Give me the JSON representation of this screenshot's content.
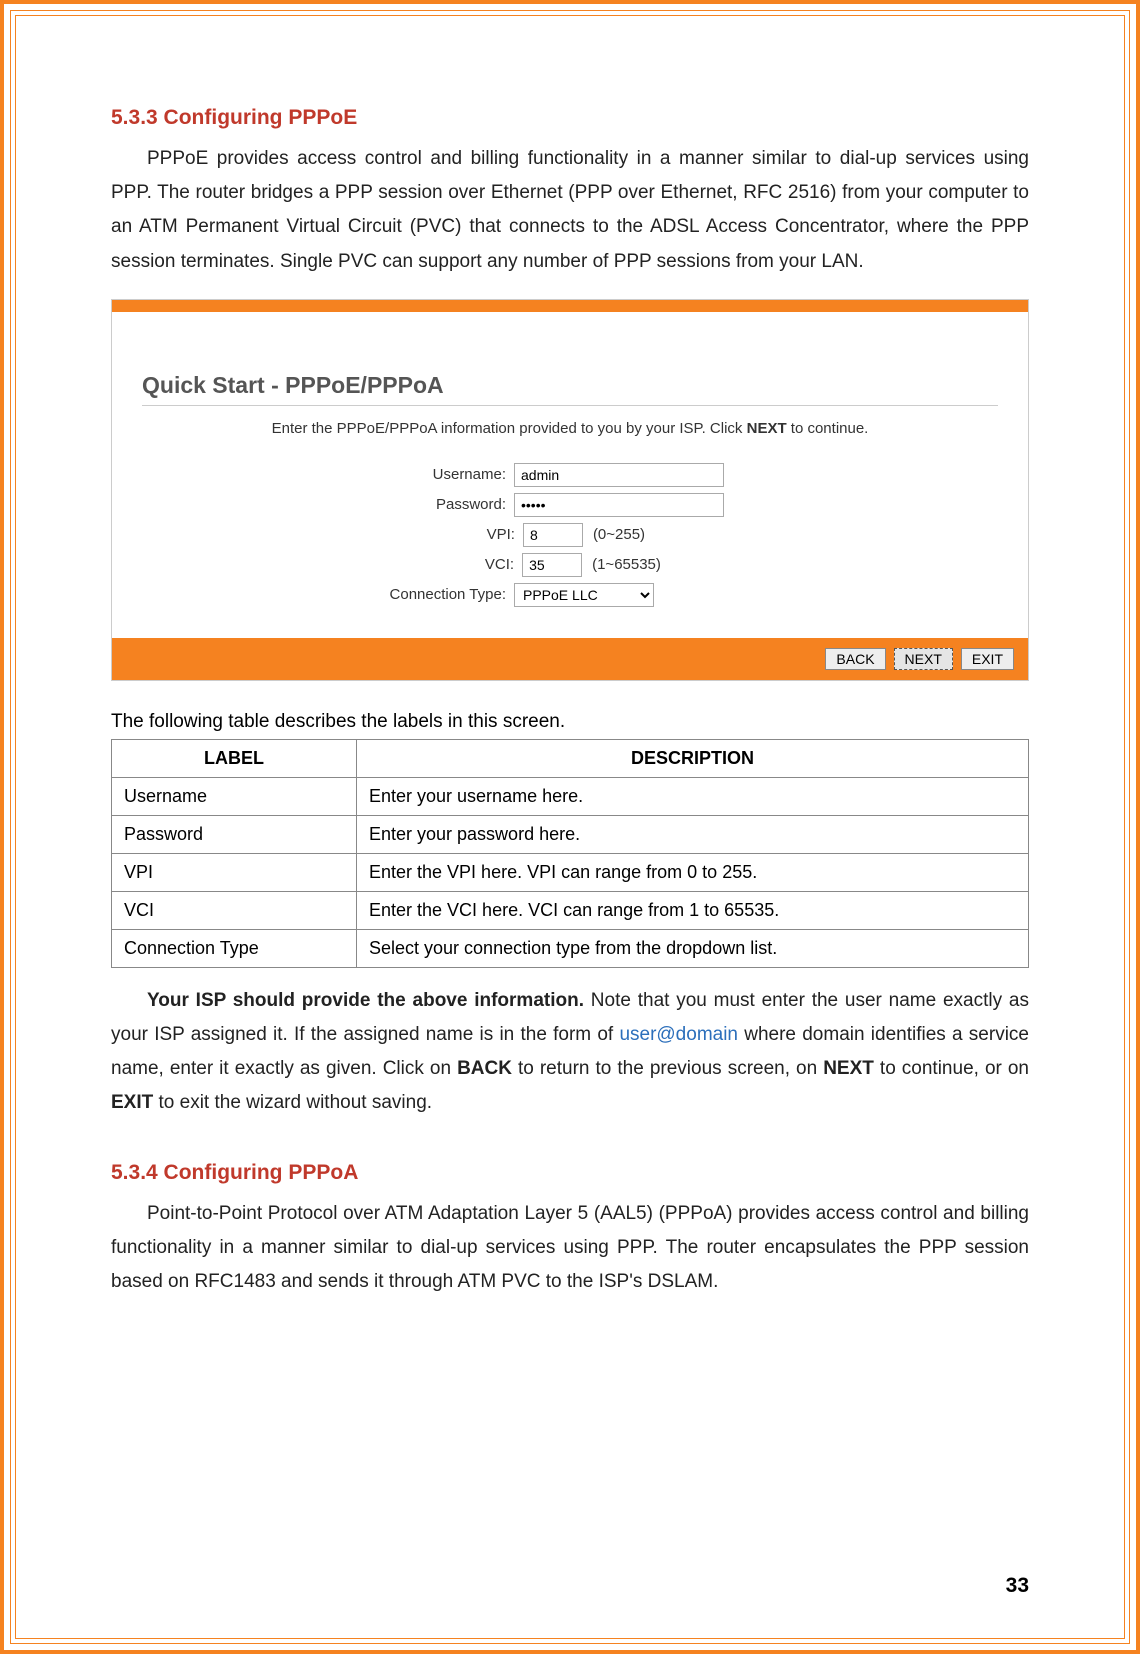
{
  "section1": {
    "heading": "5.3.3 Configuring PPPoE",
    "para": "PPPoE provides access control and billing functionality in a manner similar to dial-up services using PPP. The router bridges a PPP session over Ethernet (PPP over Ethernet, RFC 2516) from your computer to an ATM Permanent Virtual Circuit (PVC) that connects to the ADSL Access Concentrator, where the PPP session terminates. Single PVC can support any number of PPP sessions from your LAN."
  },
  "shot": {
    "title": "Quick Start - PPPoE/PPPoA",
    "instr_pre": "Enter the PPPoE/PPPoA information provided to you by your ISP. Click ",
    "instr_bold": "NEXT",
    "instr_post": " to continue.",
    "labels": {
      "username": "Username:",
      "password": "Password:",
      "vpi": "VPI:",
      "vci": "VCI:",
      "conntype": "Connection Type:"
    },
    "values": {
      "username": "admin",
      "password": "•••••",
      "vpi": "8",
      "vci": "35",
      "conntype": "PPPoE LLC"
    },
    "hints": {
      "vpi": "(0~255)",
      "vci": "(1~65535)"
    },
    "buttons": {
      "back": "BACK",
      "next": "NEXT",
      "exit": "EXIT"
    }
  },
  "table": {
    "intro": "The following table describes the labels in this screen.",
    "head_label": "LABEL",
    "head_desc": "DESCRIPTION",
    "rows": [
      {
        "label": "Username",
        "desc": "Enter your username here."
      },
      {
        "label": "Password",
        "desc": "Enter your password here."
      },
      {
        "label": "VPI",
        "desc": "Enter the VPI here. VPI can range from 0 to 255."
      },
      {
        "label": "VCI",
        "desc": "Enter the VCI here. VCI can range from 1 to 65535."
      },
      {
        "label": "Connection Type",
        "desc": "Select your connection type from the dropdown list."
      }
    ]
  },
  "after_table": {
    "bold1": "Your ISP should provide the above information.",
    "part1": " Note that you must enter the user name exactly as your ISP assigned it. If the assigned name is in the form of ",
    "link": "user@domain",
    "part2": " where domain identifies a service name, enter it exactly as given. Click on ",
    "bold_back": "BACK",
    "part3": " to return to the previous screen, on ",
    "bold_next": "NEXT",
    "part4": " to continue, or on ",
    "bold_exit": "EXIT",
    "part5": " to exit the wizard without saving."
  },
  "section2": {
    "heading": "5.3.4 Configuring PPPoA",
    "para": "Point-to-Point Protocol over ATM Adaptation Layer 5 (AAL5) (PPPoA) provides access control and billing functionality in a manner similar to dial-up services using PPP. The router encapsulates the PPP session based on RFC1483 and sends it through ATM PVC to the ISP's DSLAM."
  },
  "page_number": "33"
}
